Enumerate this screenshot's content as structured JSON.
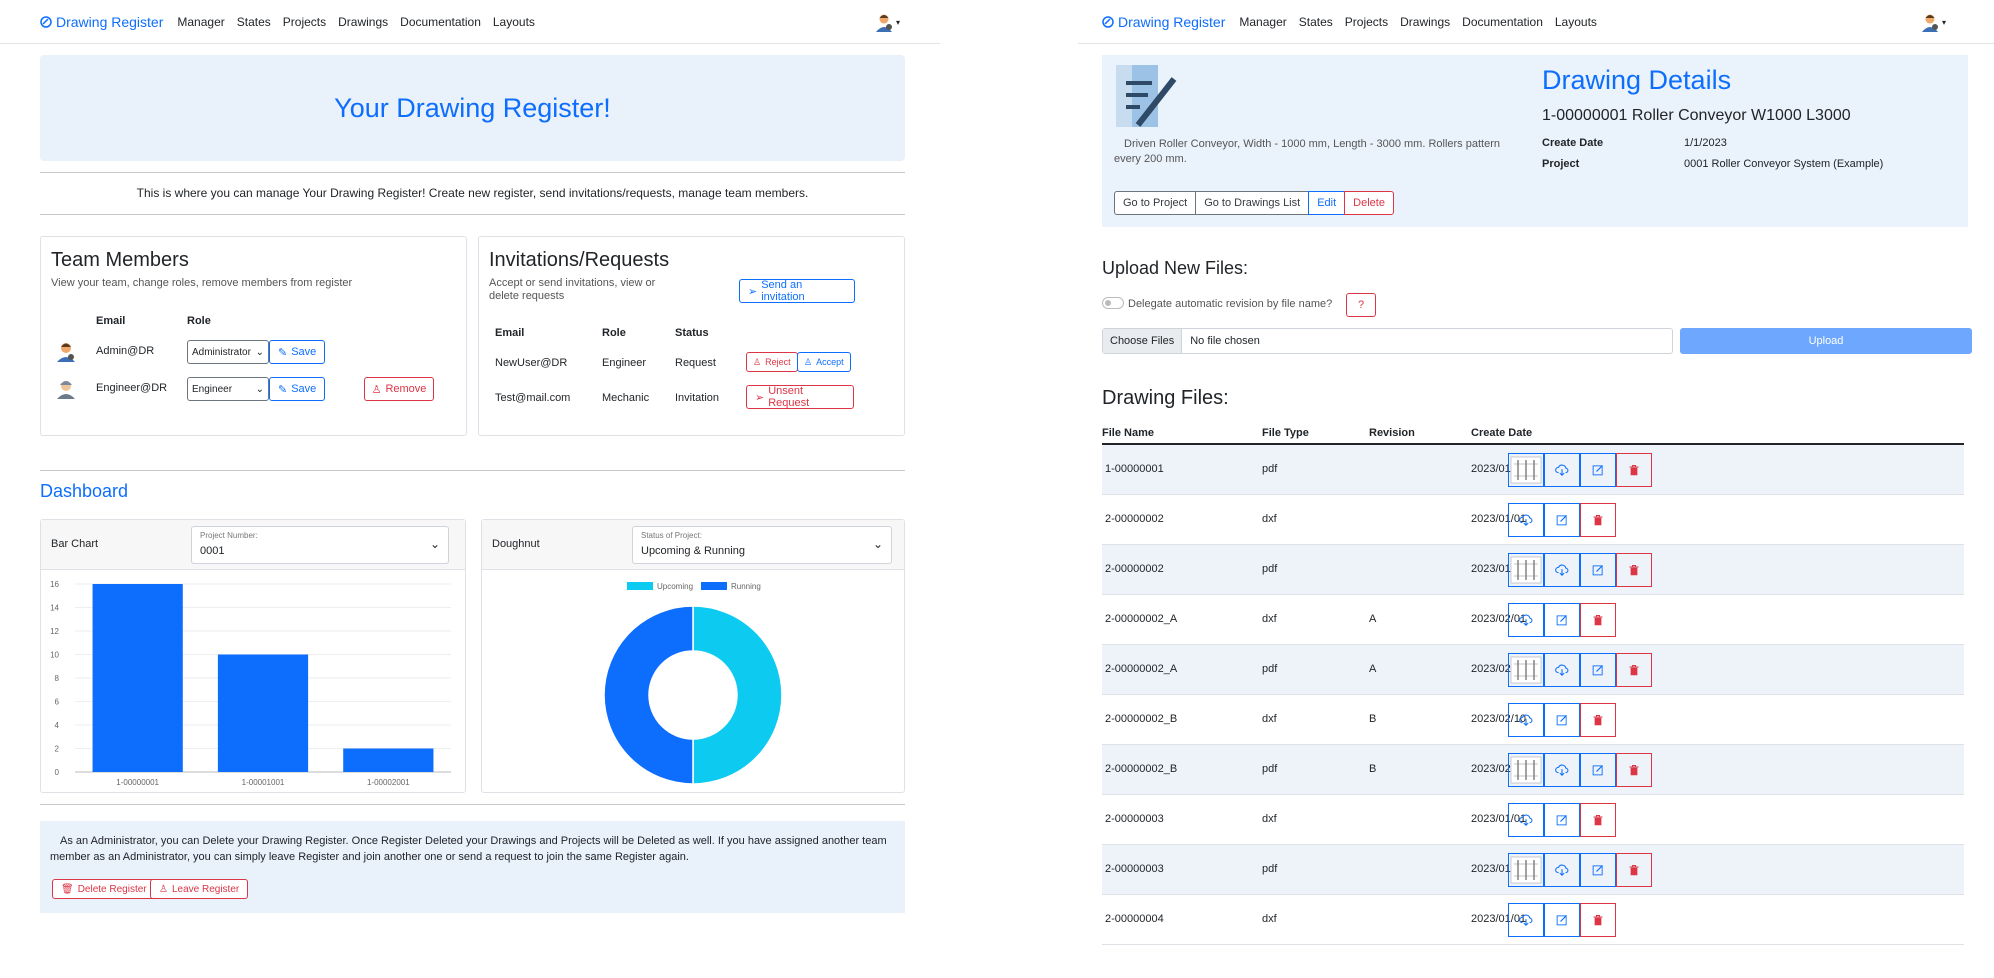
{
  "nav": {
    "brand": "Drawing Register",
    "links": [
      "Manager",
      "States",
      "Projects",
      "Drawings",
      "Documentation",
      "Layouts"
    ]
  },
  "hero": {
    "title": "Your Drawing Register!",
    "description": "This is where you can manage Your Drawing Register! Create new register, send invitations/requests, manage team members."
  },
  "team": {
    "title": "Team Members",
    "subtitle": "View your team, change roles, remove members from register",
    "col_email": "Email",
    "col_role": "Role",
    "members": [
      {
        "email": "Admin@DR",
        "role": "Administrator",
        "save": "Save"
      },
      {
        "email": "Engineer@DR",
        "role": "Engineer",
        "save": "Save"
      }
    ],
    "remove": "Remove"
  },
  "invites": {
    "title": "Invitations/Requests",
    "subtitle": "Accept or send invitations, view or delete requests",
    "send": "Send an invitation",
    "col_email": "Email",
    "col_role": "Role",
    "col_status": "Status",
    "rows": [
      {
        "email": "NewUser@DR",
        "role": "Engineer",
        "status": "Request"
      },
      {
        "email": "Test@mail.com",
        "role": "Mechanic",
        "status": "Invitation"
      }
    ],
    "reject": "Reject",
    "accept": "Accept",
    "unsent": "Unsent Request"
  },
  "dashboard": {
    "title": "Dashboard",
    "bar": {
      "label": "Bar Chart",
      "select_label": "Project Number:",
      "select_value": "0001"
    },
    "donut": {
      "label": "Doughnut",
      "select_label": "Status of Project:",
      "select_value": "Upcoming & Running"
    }
  },
  "chart_data": [
    {
      "type": "bar",
      "categories": [
        "1-00000001",
        "1-00001001",
        "1-00002001"
      ],
      "values": [
        16,
        10,
        2
      ],
      "ylim": [
        0,
        16
      ],
      "yticks": [
        0,
        2,
        4,
        6,
        8,
        10,
        12,
        14,
        16
      ],
      "colors": [
        "#0d6efd"
      ]
    },
    {
      "type": "pie",
      "labels": [
        "Upcoming",
        "Running"
      ],
      "values": [
        50,
        50
      ],
      "colors": [
        "#0dcaf0",
        "#0d6efd"
      ],
      "legend": "top"
    }
  ],
  "footer": {
    "text": "As an Administrator, you can Delete your Drawing Register. Once Register Deleted your Drawings and Projects will be Deleted as well. If you have assigned another team member as an Administrator, you can simply leave Register and join another one or send a request to join the same Register again.",
    "delete": "Delete Register",
    "leave": "Leave Register"
  },
  "details": {
    "title": "Drawing Details",
    "name": "1-00000001 Roller Conveyor W1000 L3000",
    "description": "Driven Roller Conveyor, Width - 1000 mm, Length - 3000 mm. Rollers pattern every 200 mm.",
    "create_label": "Create Date",
    "create_value": "1/1/2023",
    "project_label": "Project",
    "project_value": "0001 Roller Conveyor System (Example)",
    "btn_project": "Go to Project",
    "btn_list": "Go to Drawings List",
    "btn_edit": "Edit",
    "btn_delete": "Delete"
  },
  "upload": {
    "title": "Upload New Files:",
    "toggle_label": "Delegate automatic revision by file name?",
    "help": "?",
    "choose": "Choose Files",
    "no_file": "No file chosen",
    "upload": "Upload"
  },
  "files": {
    "title": "Drawing Files:",
    "headers": [
      "File Name",
      "File Type",
      "Revision",
      "Create Date"
    ],
    "rows": [
      {
        "name": "1-00000001",
        "type": "pdf",
        "rev": "",
        "date": "2023/01/01",
        "thumb": true
      },
      {
        "name": "2-00000002",
        "type": "dxf",
        "rev": "",
        "date": "2023/01/01",
        "thumb": false
      },
      {
        "name": "2-00000002",
        "type": "pdf",
        "rev": "",
        "date": "2023/01/01",
        "thumb": true
      },
      {
        "name": "2-00000002_A",
        "type": "dxf",
        "rev": "A",
        "date": "2023/02/01",
        "thumb": false
      },
      {
        "name": "2-00000002_A",
        "type": "pdf",
        "rev": "A",
        "date": "2023/02/01",
        "thumb": true
      },
      {
        "name": "2-00000002_B",
        "type": "dxf",
        "rev": "B",
        "date": "2023/02/10",
        "thumb": false
      },
      {
        "name": "2-00000002_B",
        "type": "pdf",
        "rev": "B",
        "date": "2023/02/10",
        "thumb": true
      },
      {
        "name": "2-00000003",
        "type": "dxf",
        "rev": "",
        "date": "2023/01/01",
        "thumb": false
      },
      {
        "name": "2-00000003",
        "type": "pdf",
        "rev": "",
        "date": "2023/01/01",
        "thumb": true
      },
      {
        "name": "2-00000004",
        "type": "dxf",
        "rev": "",
        "date": "2023/01/01",
        "thumb": false
      }
    ]
  }
}
